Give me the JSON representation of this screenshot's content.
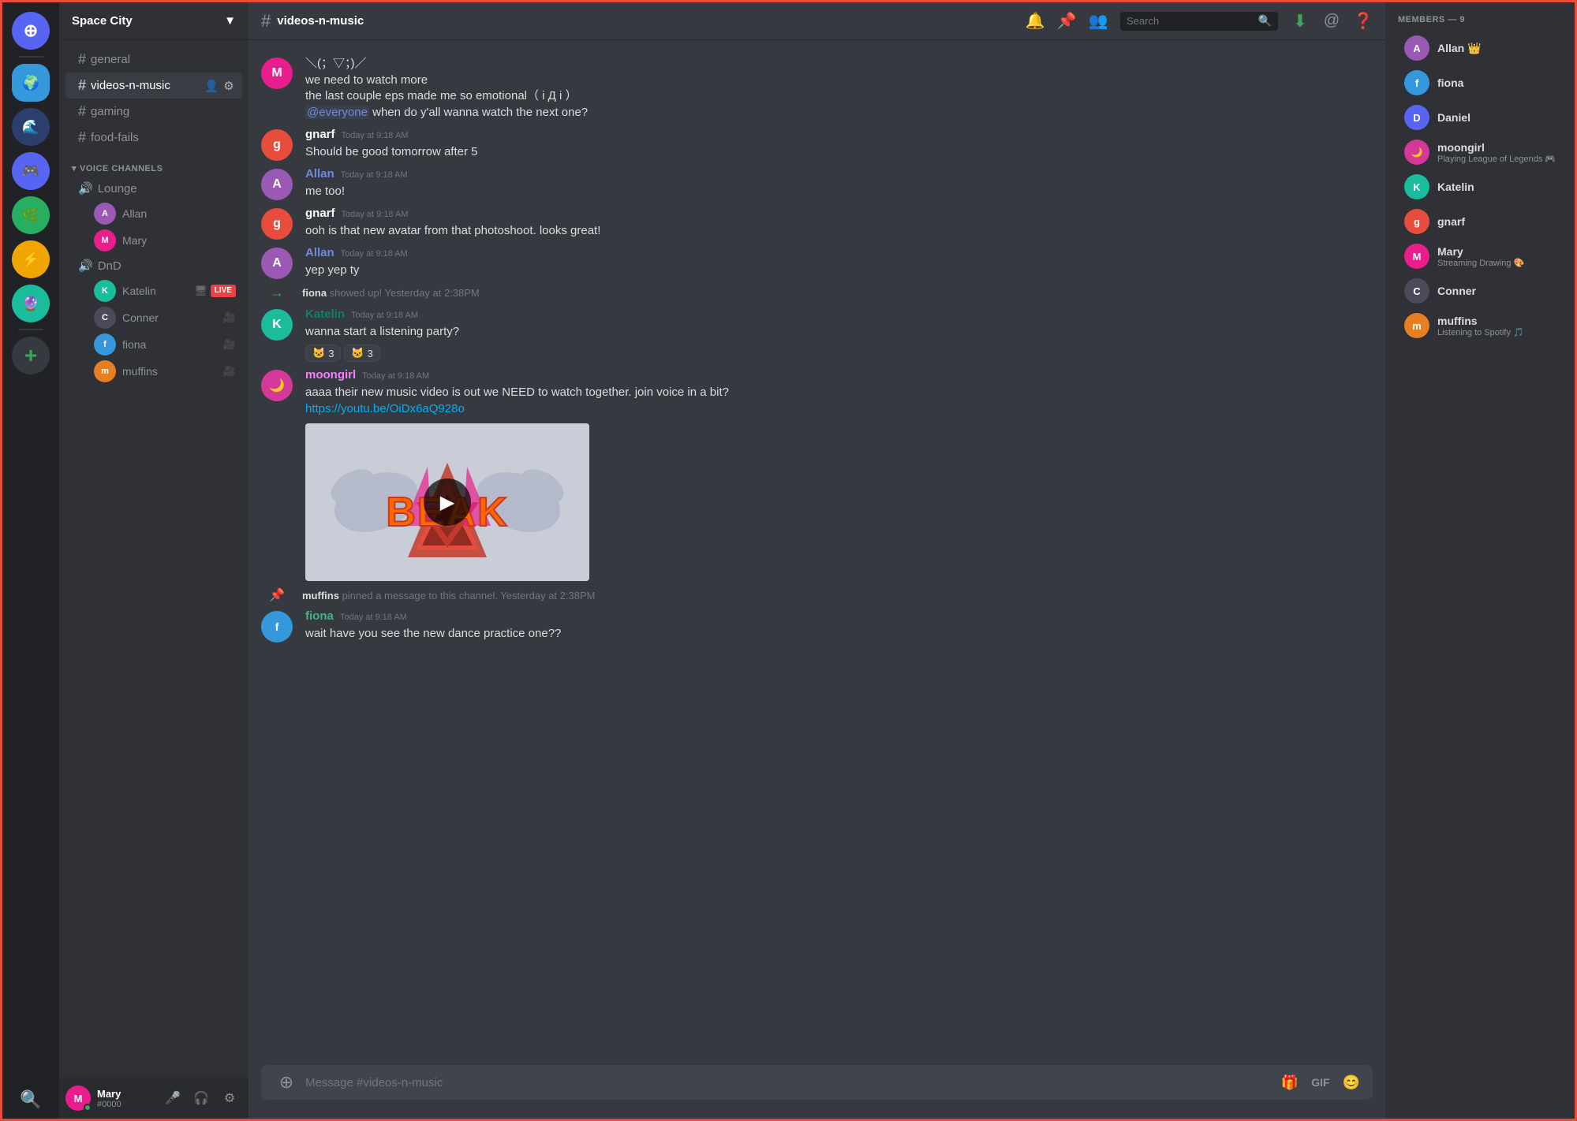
{
  "app": {
    "title": "DISCORD"
  },
  "server": {
    "name": "Space City",
    "dropdown_label": "Space City"
  },
  "channels": {
    "current": "videos-n-music",
    "text_channels": [
      {
        "name": "general",
        "id": "general"
      },
      {
        "name": "videos-n-music",
        "id": "videos-n-music",
        "active": true
      },
      {
        "name": "gaming",
        "id": "gaming"
      },
      {
        "name": "food-fails",
        "id": "food-fails"
      }
    ],
    "voice_section_label": "VOICE CHANNELS",
    "voice_channels": [
      {
        "name": "Lounge",
        "members": [
          {
            "name": "Allan",
            "color": "av-purple"
          },
          {
            "name": "Mary",
            "color": "av-pink"
          }
        ]
      },
      {
        "name": "DnD",
        "members": [
          {
            "name": "Katelin",
            "color": "av-teal",
            "live": true
          },
          {
            "name": "Conner",
            "color": "av-dark",
            "cam": true
          },
          {
            "name": "fiona",
            "color": "av-blue",
            "cam": true
          },
          {
            "name": "muffins",
            "color": "av-orange",
            "cam": true
          }
        ]
      }
    ]
  },
  "user": {
    "name": "Mary",
    "tag": "#0000",
    "status": "online"
  },
  "header": {
    "channel_name": "videos-n-music",
    "search_placeholder": "Search"
  },
  "messages": [
    {
      "id": "msg1",
      "type": "continued",
      "text": "＼(；▽；)／",
      "lines": [
        "we need to watch more",
        "the last couple eps made me so emotional（ i Д i ）",
        "@everyone when do y'all wanna watch the next one?"
      ],
      "has_mention": true
    },
    {
      "id": "msg2",
      "type": "message",
      "author": "gnarf",
      "author_color": "name-white",
      "avatar_color": "av-red",
      "timestamp": "Today at 9:18 AM",
      "text": "Should be good tomorrow after 5"
    },
    {
      "id": "msg3",
      "type": "message",
      "author": "Allan",
      "author_color": "name-blue",
      "avatar_color": "av-purple",
      "timestamp": "Today at 9:18 AM",
      "text": "me too!"
    },
    {
      "id": "msg4",
      "type": "message",
      "author": "gnarf",
      "author_color": "name-white",
      "avatar_color": "av-red",
      "timestamp": "Today at 9:18 AM",
      "text": "ooh is that new avatar from that photoshoot. looks great!"
    },
    {
      "id": "msg5",
      "type": "message",
      "author": "Allan",
      "author_color": "name-blue",
      "avatar_color": "av-purple",
      "timestamp": "Today at 9:18 AM",
      "text": "yep yep ty"
    },
    {
      "id": "msg6",
      "type": "system_joined",
      "actor": "fiona",
      "action": "showed up!",
      "timestamp": "Yesterday at 2:38PM"
    },
    {
      "id": "msg7",
      "type": "message",
      "author": "Katelin",
      "author_color": "name-teal",
      "avatar_color": "av-teal",
      "timestamp": "Today at 9:18 AM",
      "text": "wanna start a listening party?",
      "reactions": [
        {
          "emoji": "🐱",
          "count": 3
        },
        {
          "emoji": "🐱",
          "count": 3
        }
      ]
    },
    {
      "id": "msg8",
      "type": "message",
      "author": "moongirl",
      "author_color": "name-pink",
      "avatar_color": "av-pink",
      "timestamp": "Today at 9:18 AM",
      "text": "aaaa their new music video is out we NEED to watch together. join voice in a bit?",
      "link": "https://youtu.be/OiDx6aQ928o",
      "has_embed": true
    },
    {
      "id": "msg9",
      "type": "system_pin",
      "actor": "muffins",
      "action": "pinned a message to this channel.",
      "timestamp": "Yesterday at 2:38PM"
    },
    {
      "id": "msg10",
      "type": "message",
      "author": "fiona",
      "author_color": "name-green",
      "avatar_color": "av-blue",
      "timestamp": "Today at 9:18 AM",
      "text": "wait have you see the new dance practice one??"
    }
  ],
  "embed": {
    "alt": "BEAK music video thumbnail"
  },
  "input": {
    "placeholder": "Message #videos-n-music"
  },
  "members": {
    "header": "MEMBERS — 9",
    "list": [
      {
        "name": "Allan",
        "crown": true,
        "color": "av-purple"
      },
      {
        "name": "fiona",
        "color": "av-blue"
      },
      {
        "name": "Daniel",
        "color": "av-indigo"
      },
      {
        "name": "moongirl",
        "color": "av-pink",
        "status": "Playing League of Legends"
      },
      {
        "name": "Katelin",
        "color": "av-teal"
      },
      {
        "name": "gnarf",
        "color": "av-red"
      },
      {
        "name": "Mary",
        "color": "av-pink",
        "status": "Streaming Drawing 🎨"
      },
      {
        "name": "Conner",
        "color": "av-dark"
      },
      {
        "name": "muffins",
        "color": "av-orange",
        "status": "Listening to Spotify 🎵"
      }
    ]
  }
}
